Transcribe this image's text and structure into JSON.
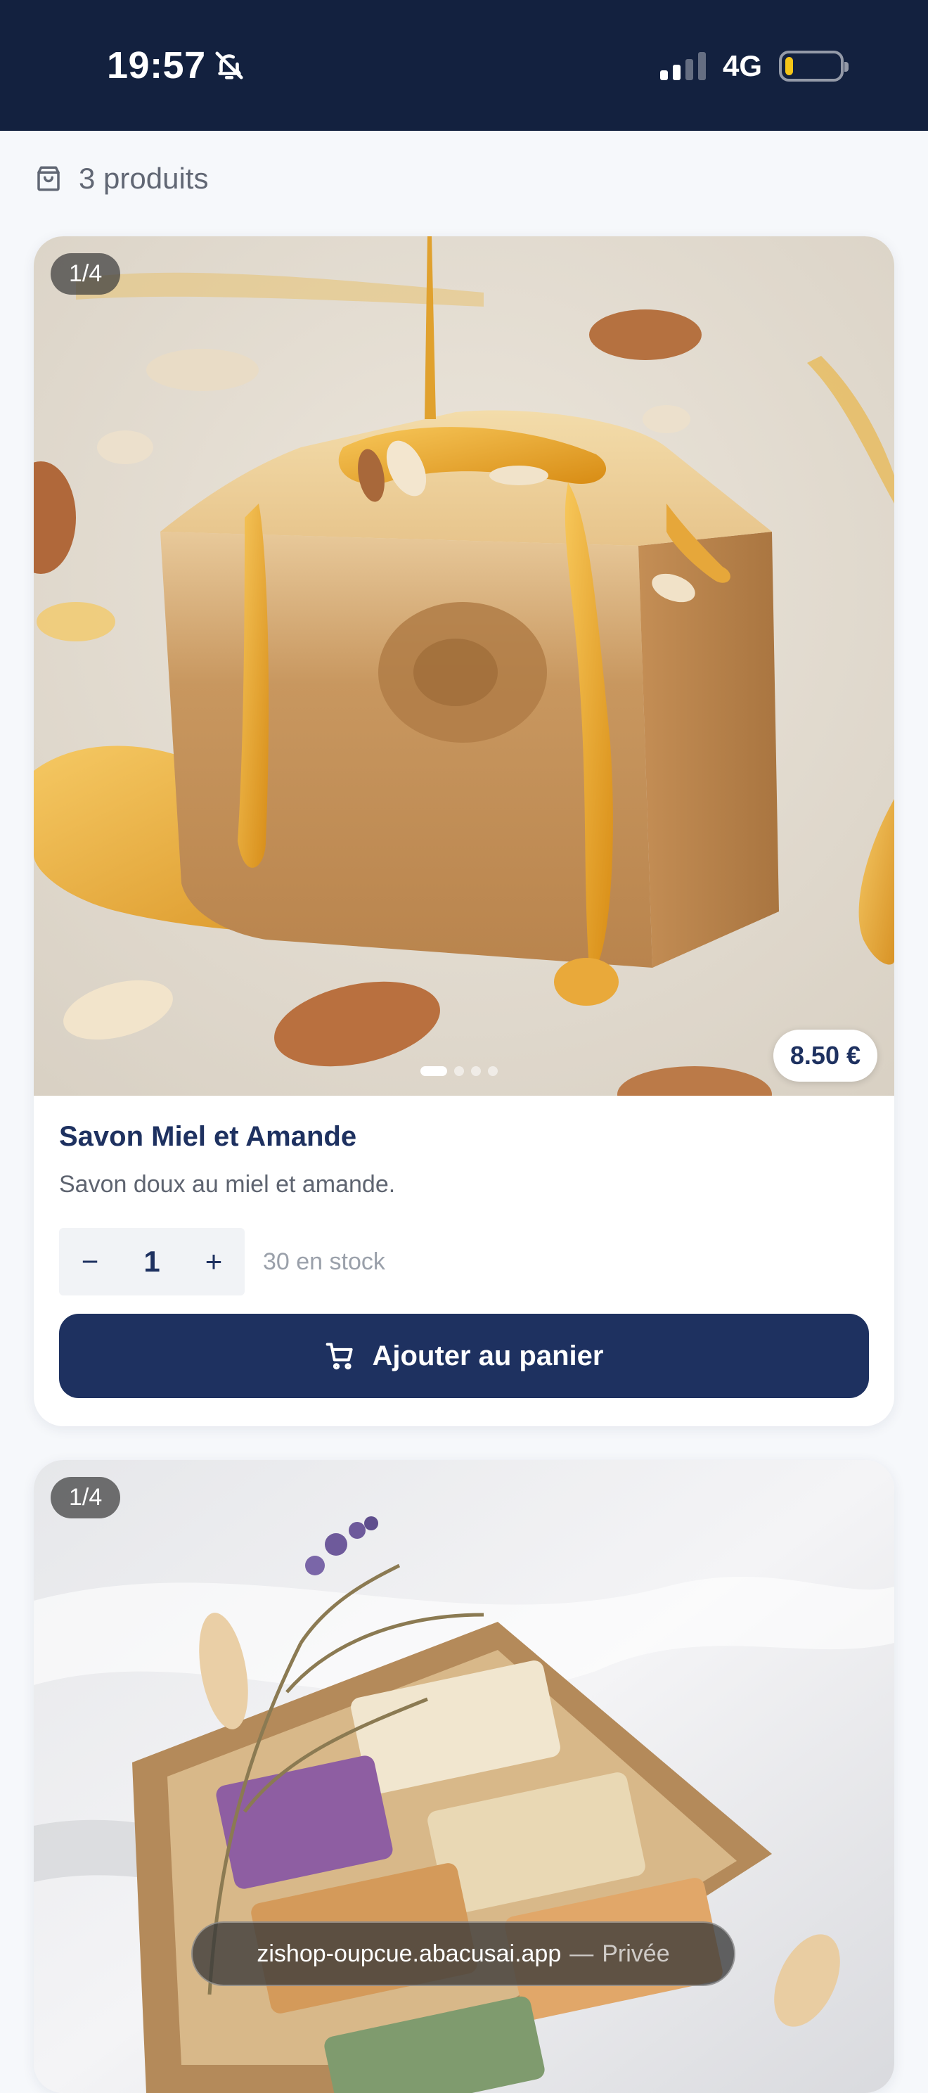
{
  "status_bar": {
    "time": "19:57",
    "network": "4G",
    "battery_level_percent": 15,
    "signal_bars_active": 2,
    "signal_bars_total": 4
  },
  "cart_summary": {
    "count_text": "3 produits"
  },
  "products": [
    {
      "image_counter": "1/4",
      "price": "8.50 €",
      "name": "Savon Miel et Amande",
      "description": "Savon doux au miel et amande.",
      "quantity": "1",
      "decrement_symbol": "−",
      "increment_symbol": "+",
      "stock": "30 en stock",
      "add_label": "Ajouter au panier",
      "carousel_active_index": 1,
      "carousel_total": 4
    },
    {
      "image_counter": "1/4"
    }
  ],
  "browser": {
    "url": "zishop-oupcue.abacusai.app",
    "separator": "—",
    "mode": "Privée"
  },
  "colors": {
    "status_bar_bg": "#13213f",
    "primary": "#1e3160",
    "page_bg": "#f6f8fb",
    "battery": "#f5c518"
  }
}
